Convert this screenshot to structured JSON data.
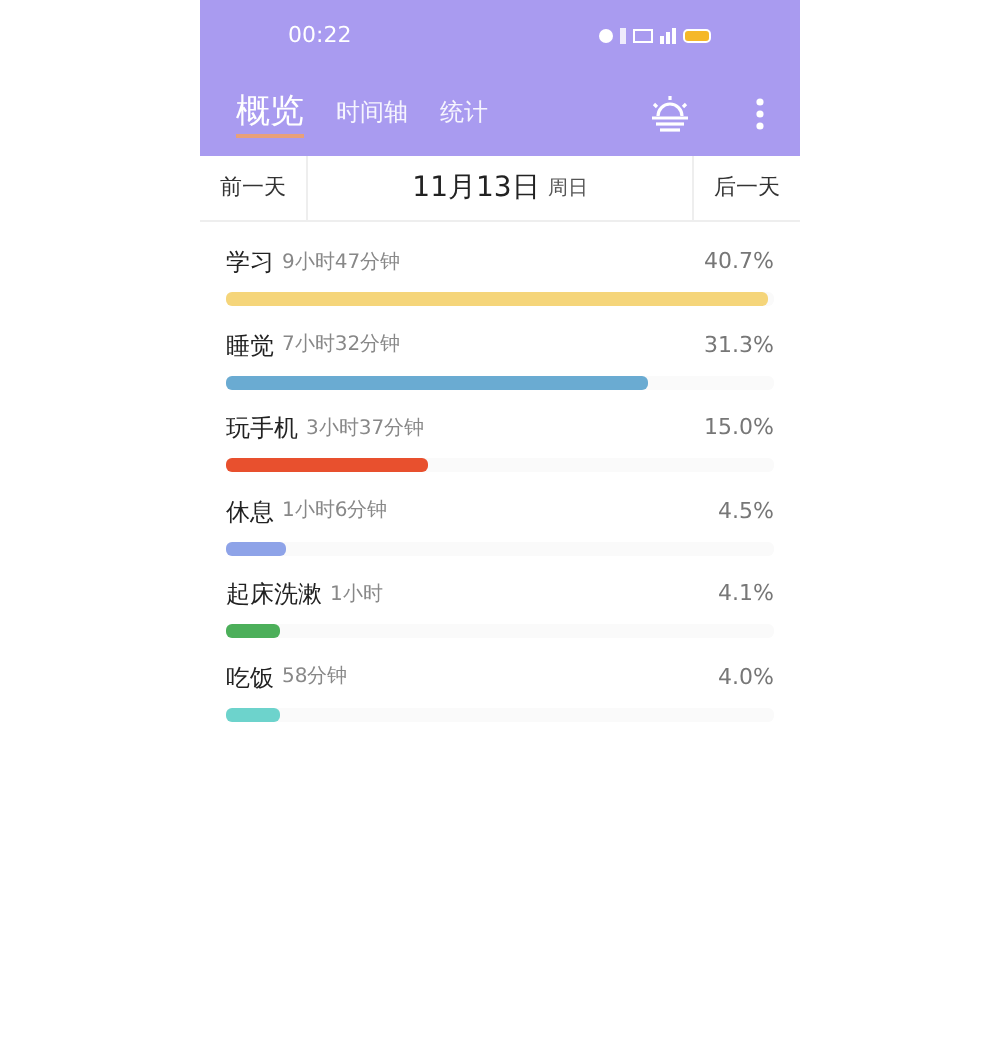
{
  "status_bar": {
    "time": "00:22"
  },
  "tabs": [
    {
      "label": "概览",
      "selected": true
    },
    {
      "label": "时间轴",
      "selected": false
    },
    {
      "label": "统计",
      "selected": false
    }
  ],
  "date_bar": {
    "prev": "前一天",
    "date": "11月13日",
    "weekday": "周日",
    "next": "后一天"
  },
  "activities": [
    {
      "name": "学习",
      "duration": "9小时47分钟",
      "percent": "40.7%",
      "level": 0.99,
      "color": "#f5d57a"
    },
    {
      "name": "睡觉",
      "duration": "7小时32分钟",
      "percent": "31.3%",
      "level": 0.77,
      "color": "#6aabd2"
    },
    {
      "name": "玩手机",
      "duration": "3小时37分钟",
      "percent": "15.0%",
      "level": 0.37,
      "color": "#e8502e"
    },
    {
      "name": "休息",
      "duration": "1小时6分钟",
      "percent": "4.5%",
      "level": 0.11,
      "color": "#8ea3e8"
    },
    {
      "name": "起床洗漱",
      "duration": "1小时",
      "percent": "4.1%",
      "level": 0.1,
      "color": "#4caf5a"
    },
    {
      "name": "吃饭",
      "duration": "58分钟",
      "percent": "4.0%",
      "level": 0.1,
      "color": "#6dd3cc"
    }
  ]
}
